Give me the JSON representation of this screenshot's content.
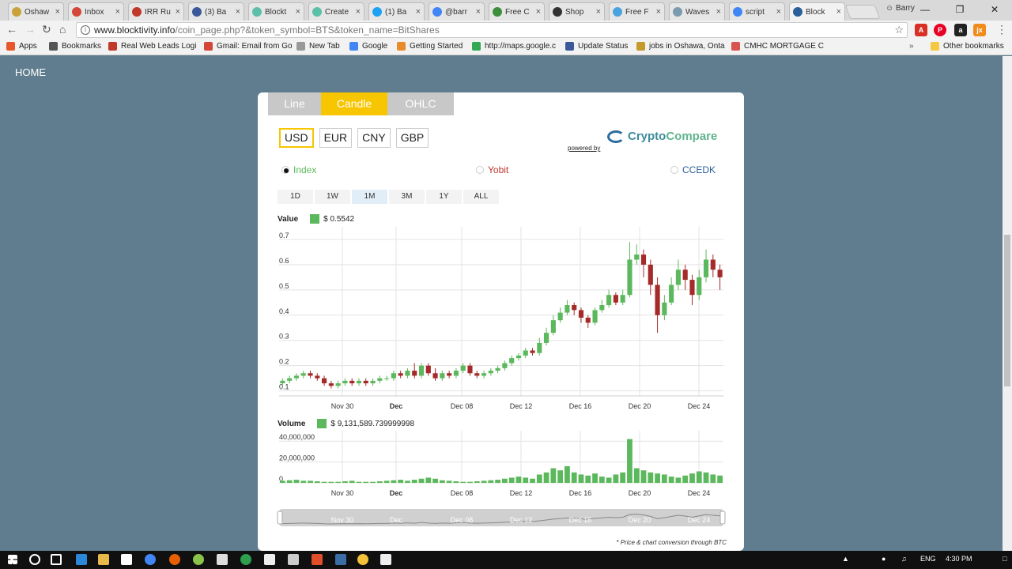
{
  "browser": {
    "tabs": [
      "Oshaw",
      "Inbox",
      "IRR Ru",
      "(3) Ba",
      "Blockt",
      "Create",
      "(1) Ba",
      "@barr",
      "Free C",
      "Shop",
      "Free F",
      "Waves",
      "script",
      "Block"
    ],
    "tab_colors": [
      "#c9a33a",
      "#d44638",
      "#c0392b",
      "#3b5998",
      "#5cbfa8",
      "#5cbfa8",
      "#1da1f2",
      "#4285f4",
      "#3b8f3b",
      "#333333",
      "#4aa3df",
      "#7a9ab0",
      "#4285f4",
      "#2a6099"
    ],
    "profile": "Barry",
    "url_host": "www.blocktivity.info",
    "url_path": "/coin_page.php?&token_symbol=BTS&token_name=BitShares",
    "bookmarks": [
      "Apps",
      "Bookmarks",
      "Real Web Leads Logi",
      "Gmail: Email from Go",
      "New Tab",
      "Google",
      "Getting Started",
      "http://maps.google.c",
      "Update Status",
      "jobs in Oshawa, Onta",
      "CMHC MORTGAGE C"
    ],
    "other_bookmarks": "Other bookmarks"
  },
  "nav": {
    "home": "HOME"
  },
  "chart_tabs": [
    "Line",
    "Candle",
    "OHLC"
  ],
  "currencies": [
    "USD",
    "EUR",
    "CNY",
    "GBP"
  ],
  "logo": {
    "part1": "Crypto ",
    "part2": "Compare",
    "powered": "powered by"
  },
  "exchanges": [
    "Index",
    "Yobit",
    "CCEDK"
  ],
  "ranges": [
    "1D",
    "1W",
    "1M",
    "3M",
    "1Y",
    "ALL"
  ],
  "value_legend": {
    "label": "Value",
    "value": "$ 0.5542"
  },
  "volume_legend": {
    "label": "Volume",
    "value": "$ 9,131,589.739999998"
  },
  "footnote": "* Price & chart conversion through BTC",
  "chart_data": [
    {
      "type": "candlestick",
      "title": "",
      "xlabel": "",
      "ylabel": "",
      "ylim": [
        0.08,
        0.75
      ],
      "yticks": [
        0.1,
        0.2,
        0.3,
        0.4,
        0.5,
        0.6,
        0.7
      ],
      "xticks": [
        "Nov 30",
        "Dec",
        "Dec 08",
        "Dec 12",
        "Dec 16",
        "Dec 20",
        "Dec 24"
      ],
      "up_color": "#5cb85c",
      "down_color": "#a52a2a",
      "x_start": "Nov 25",
      "x_step_days": 0.5,
      "candles": [
        [
          0.13,
          0.14,
          0.15,
          0.12
        ],
        [
          0.14,
          0.15,
          0.16,
          0.13
        ],
        [
          0.15,
          0.16,
          0.17,
          0.14
        ],
        [
          0.16,
          0.17,
          0.18,
          0.15
        ],
        [
          0.17,
          0.16,
          0.18,
          0.15
        ],
        [
          0.16,
          0.15,
          0.17,
          0.14
        ],
        [
          0.15,
          0.13,
          0.16,
          0.12
        ],
        [
          0.13,
          0.12,
          0.14,
          0.11
        ],
        [
          0.12,
          0.13,
          0.14,
          0.11
        ],
        [
          0.13,
          0.14,
          0.15,
          0.12
        ],
        [
          0.14,
          0.13,
          0.15,
          0.12
        ],
        [
          0.13,
          0.14,
          0.15,
          0.12
        ],
        [
          0.14,
          0.13,
          0.15,
          0.12
        ],
        [
          0.13,
          0.14,
          0.15,
          0.12
        ],
        [
          0.14,
          0.15,
          0.16,
          0.13
        ],
        [
          0.15,
          0.15,
          0.16,
          0.14
        ],
        [
          0.15,
          0.17,
          0.18,
          0.14
        ],
        [
          0.17,
          0.16,
          0.18,
          0.15
        ],
        [
          0.16,
          0.18,
          0.19,
          0.15
        ],
        [
          0.18,
          0.16,
          0.21,
          0.15
        ],
        [
          0.16,
          0.2,
          0.21,
          0.15
        ],
        [
          0.2,
          0.17,
          0.21,
          0.16
        ],
        [
          0.17,
          0.15,
          0.19,
          0.14
        ],
        [
          0.15,
          0.17,
          0.18,
          0.14
        ],
        [
          0.17,
          0.16,
          0.18,
          0.15
        ],
        [
          0.16,
          0.18,
          0.19,
          0.15
        ],
        [
          0.18,
          0.2,
          0.21,
          0.17
        ],
        [
          0.2,
          0.17,
          0.21,
          0.16
        ],
        [
          0.17,
          0.16,
          0.18,
          0.15
        ],
        [
          0.16,
          0.17,
          0.18,
          0.15
        ],
        [
          0.17,
          0.18,
          0.19,
          0.16
        ],
        [
          0.18,
          0.19,
          0.2,
          0.17
        ],
        [
          0.19,
          0.21,
          0.22,
          0.18
        ],
        [
          0.21,
          0.23,
          0.24,
          0.2
        ],
        [
          0.23,
          0.24,
          0.25,
          0.22
        ],
        [
          0.24,
          0.26,
          0.27,
          0.23
        ],
        [
          0.26,
          0.25,
          0.27,
          0.24
        ],
        [
          0.25,
          0.29,
          0.31,
          0.24
        ],
        [
          0.29,
          0.33,
          0.35,
          0.28
        ],
        [
          0.33,
          0.38,
          0.4,
          0.32
        ],
        [
          0.38,
          0.41,
          0.43,
          0.37
        ],
        [
          0.41,
          0.44,
          0.46,
          0.4
        ],
        [
          0.44,
          0.42,
          0.45,
          0.4
        ],
        [
          0.42,
          0.39,
          0.43,
          0.37
        ],
        [
          0.39,
          0.37,
          0.4,
          0.35
        ],
        [
          0.37,
          0.42,
          0.43,
          0.36
        ],
        [
          0.42,
          0.44,
          0.46,
          0.41
        ],
        [
          0.44,
          0.48,
          0.5,
          0.43
        ],
        [
          0.48,
          0.45,
          0.49,
          0.44
        ],
        [
          0.45,
          0.48,
          0.5,
          0.44
        ],
        [
          0.48,
          0.62,
          0.69,
          0.47
        ],
        [
          0.62,
          0.64,
          0.68,
          0.6
        ],
        [
          0.64,
          0.6,
          0.66,
          0.55
        ],
        [
          0.6,
          0.52,
          0.62,
          0.48
        ],
        [
          0.52,
          0.4,
          0.55,
          0.33
        ],
        [
          0.4,
          0.45,
          0.48,
          0.38
        ],
        [
          0.45,
          0.52,
          0.55,
          0.44
        ],
        [
          0.52,
          0.58,
          0.62,
          0.5
        ],
        [
          0.58,
          0.54,
          0.6,
          0.5
        ],
        [
          0.54,
          0.48,
          0.56,
          0.44
        ],
        [
          0.48,
          0.55,
          0.58,
          0.46
        ],
        [
          0.55,
          0.62,
          0.66,
          0.53
        ],
        [
          0.62,
          0.58,
          0.64,
          0.55
        ],
        [
          0.58,
          0.55,
          0.6,
          0.5
        ]
      ]
    },
    {
      "type": "bar",
      "title": "",
      "ylim": [
        0,
        50000000
      ],
      "yticks": [
        0,
        20000000,
        40000000
      ],
      "ytick_labels": [
        "0",
        "20,000,000",
        "40,000,000"
      ],
      "xticks": [
        "Nov 30",
        "Dec",
        "Dec 08",
        "Dec 12",
        "Dec 16",
        "Dec 20",
        "Dec 24"
      ],
      "color": "#5cb85c",
      "values": [
        2,
        2.5,
        3,
        2,
        2,
        1.5,
        1,
        1,
        1,
        1.5,
        2,
        1,
        1,
        1,
        1.5,
        2,
        2.5,
        3,
        2,
        3,
        4,
        5,
        4,
        2.5,
        2,
        1.5,
        1,
        1,
        1.5,
        2,
        2.5,
        3,
        4,
        5,
        6,
        5,
        4,
        8,
        10,
        14,
        12,
        16,
        10,
        8,
        7,
        9,
        6,
        5,
        8,
        10,
        42,
        14,
        12,
        10,
        9,
        8,
        6,
        5,
        7,
        9,
        11,
        10,
        8,
        7
      ]
    }
  ],
  "navigator": {
    "labels": [
      "Nov 30",
      "Dec",
      "Dec 08",
      "Dec 12",
      "Dec 16",
      "Dec 20",
      "Dec 24"
    ]
  },
  "taskbar": {
    "lang": "ENG",
    "time": "4:30 PM"
  }
}
